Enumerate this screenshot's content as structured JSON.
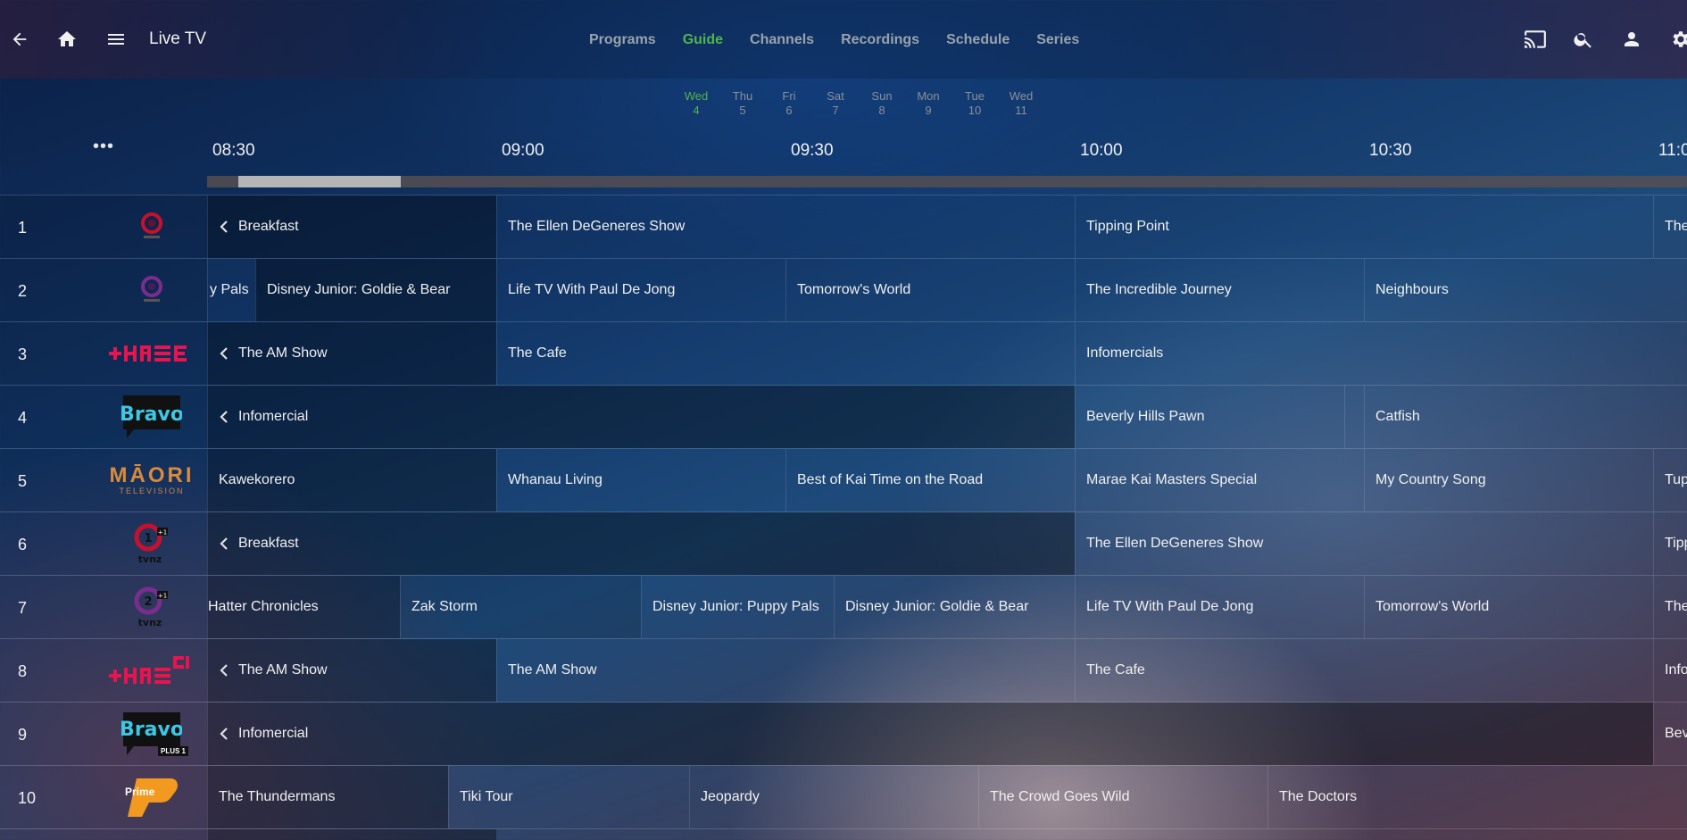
{
  "header": {
    "title": "Live TV",
    "tabs": [
      "Programs",
      "Guide",
      "Channels",
      "Recordings",
      "Schedule",
      "Series"
    ],
    "active_tab": "Guide",
    "accent_color": "#52b54b"
  },
  "days": [
    {
      "name": "Wed",
      "num": "4",
      "active": true
    },
    {
      "name": "Thu",
      "num": "5"
    },
    {
      "name": "Fri",
      "num": "6"
    },
    {
      "name": "Sat",
      "num": "7"
    },
    {
      "name": "Sun",
      "num": "8"
    },
    {
      "name": "Mon",
      "num": "9"
    },
    {
      "name": "Tue",
      "num": "10"
    },
    {
      "name": "Wed",
      "num": "11"
    }
  ],
  "timeline": {
    "more": "•••",
    "times": [
      "08:30",
      "09:00",
      "09:30",
      "10:00",
      "10:30",
      "11:00"
    ]
  },
  "channels": [
    {
      "number": "1",
      "logo": "tvnz-1-logo",
      "programs": [
        {
          "title": "Breakfast",
          "cont": true,
          "dark": true
        },
        {
          "title": "The Ellen DeGeneres Show"
        },
        {
          "title": "Tipping Point"
        },
        {
          "title": "The"
        }
      ]
    },
    {
      "number": "2",
      "logo": "tvnz-2-logo",
      "programs": [
        {
          "title": "y Pals"
        },
        {
          "title": "Disney Junior: Goldie & Bear",
          "dark": true
        },
        {
          "title": "Life TV With Paul De Jong"
        },
        {
          "title": "Tomorrow's World"
        },
        {
          "title": "The Incredible Journey"
        },
        {
          "title": "Neighbours"
        }
      ]
    },
    {
      "number": "3",
      "logo": "three-logo",
      "programs": [
        {
          "title": "The AM Show",
          "cont": true,
          "dark": true
        },
        {
          "title": "The Cafe"
        },
        {
          "title": "Infomercials"
        }
      ]
    },
    {
      "number": "4",
      "logo": "bravo-logo",
      "programs": [
        {
          "title": "Infomercial",
          "cont": true,
          "dark": true
        },
        {
          "title": "Beverly Hills Pawn"
        },
        {
          "title": ""
        },
        {
          "title": "Catfish"
        }
      ]
    },
    {
      "number": "5",
      "logo": "maori-television-logo",
      "logo_text": "MĀORI",
      "logo_sub": "TELEVISION",
      "programs": [
        {
          "title": "Kawekorero",
          "dark": true
        },
        {
          "title": "Whanau Living"
        },
        {
          "title": "Best of Kai Time on the Road"
        },
        {
          "title": "Marae Kai Masters Special"
        },
        {
          "title": "My Country Song"
        },
        {
          "title": "Tup"
        }
      ]
    },
    {
      "number": "6",
      "logo": "tvnz-1-plus1-logo",
      "programs": [
        {
          "title": "Breakfast",
          "cont": true,
          "dark": true
        },
        {
          "title": "The Ellen DeGeneres Show"
        },
        {
          "title": "Tipp"
        }
      ]
    },
    {
      "number": "7",
      "logo": "tvnz-2-plus1-logo",
      "programs": [
        {
          "title": "Hatter Chronicles",
          "dark": true
        },
        {
          "title": "Zak Storm"
        },
        {
          "title": "Disney Junior: Puppy Pals"
        },
        {
          "title": "Disney Junior: Goldie & Bear"
        },
        {
          "title": "Life TV With Paul De Jong"
        },
        {
          "title": "Tomorrow's World"
        },
        {
          "title": "The"
        }
      ]
    },
    {
      "number": "8",
      "logo": "three-plus1-logo",
      "programs": [
        {
          "title": "The AM Show",
          "cont": true,
          "dark": true
        },
        {
          "title": "The AM Show"
        },
        {
          "title": "The Cafe"
        },
        {
          "title": "Info"
        }
      ]
    },
    {
      "number": "9",
      "logo": "bravo-plus1-logo",
      "logo_sub": "PLUS 1",
      "programs": [
        {
          "title": "Infomercial",
          "cont": true,
          "dark": true
        },
        {
          "title": "Bev"
        }
      ]
    },
    {
      "number": "10",
      "logo": "prime-logo",
      "logo_text": "Prime",
      "programs": [
        {
          "title": "The Thundermans",
          "dark": true
        },
        {
          "title": "Tiki Tour"
        },
        {
          "title": "Jeopardy"
        },
        {
          "title": "The Crowd Goes Wild"
        },
        {
          "title": "The Doctors"
        }
      ]
    }
  ]
}
